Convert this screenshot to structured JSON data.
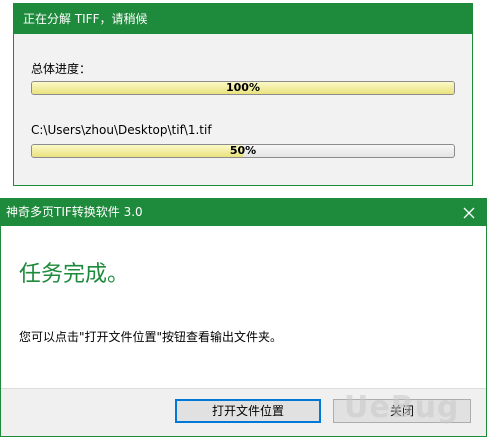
{
  "progress_window": {
    "title": "正在分解 TIFF，请稍候",
    "overall": {
      "label": "总体进度：",
      "percent": 100,
      "percent_text": "100%"
    },
    "file": {
      "path": "C:\\Users\\zhou\\Desktop\\tif\\1.tif",
      "percent": 50,
      "percent_text": "50%"
    }
  },
  "dialog": {
    "title": "神奇多页TIF转换软件 3.0",
    "heading": "任务完成。",
    "message": "您可以点击\"打开文件位置\"按钮查看输出文件夹。",
    "buttons": {
      "open_location": "打开文件位置",
      "close": "关闭"
    }
  },
  "icons": {
    "close": "close-icon"
  },
  "watermark": "UeBug",
  "colors": {
    "accent": "#1e8a3b",
    "progress_fill": "#eae27e"
  }
}
